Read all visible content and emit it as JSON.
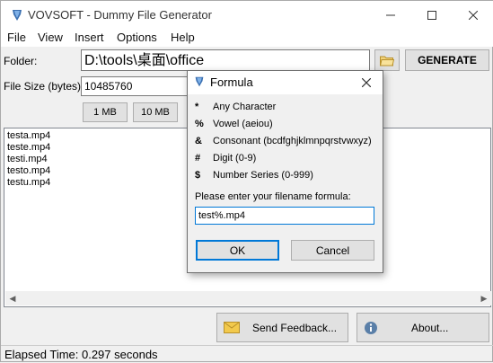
{
  "window": {
    "title": "VOVSOFT - Dummy File Generator"
  },
  "menu": [
    "File",
    "View",
    "Insert",
    "Options",
    "Help"
  ],
  "folder": {
    "label": "Folder:",
    "value": "D:\\tools\\桌面\\office",
    "generate_label": "GENERATE"
  },
  "file_size": {
    "label": "File Size (bytes):",
    "value": "10485760"
  },
  "size_buttons": [
    "1 MB",
    "10 MB"
  ],
  "file_list": [
    "testa.mp4",
    "teste.mp4",
    "testi.mp4",
    "testo.mp4",
    "testu.mp4"
  ],
  "footer": {
    "feedback_label": "Send Feedback...",
    "about_label": "About..."
  },
  "status": "Elapsed Time: 0.297 seconds",
  "formula_dialog": {
    "title": "Formula",
    "rules": [
      {
        "symbol": "*",
        "text": "Any Character"
      },
      {
        "symbol": "%",
        "text": "Vowel (aeiou)"
      },
      {
        "symbol": "&",
        "text": "Consonant (bcdfghjklmnpqrstvwxyz)"
      },
      {
        "symbol": "#",
        "text": "Digit (0-9)"
      },
      {
        "symbol": "$",
        "text": "Number Series (0-999)"
      }
    ],
    "prompt": "Please enter your filename formula:",
    "formula_value": "test%.mp4",
    "ok_label": "OK",
    "cancel_label": "Cancel"
  }
}
